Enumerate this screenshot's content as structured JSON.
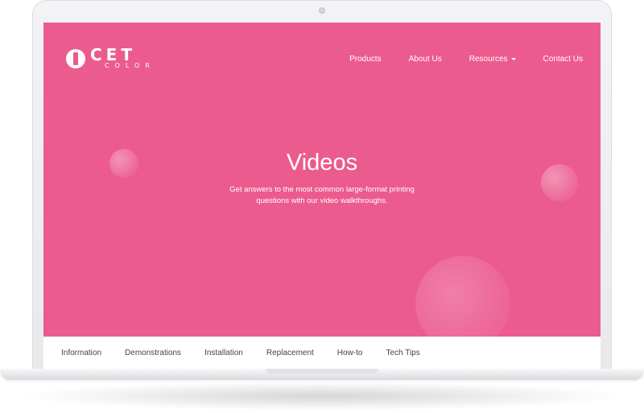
{
  "brand": {
    "logo_word": "CET",
    "logo_sub": "COLOR"
  },
  "nav": {
    "items": [
      {
        "label": "Products",
        "has_dropdown": false
      },
      {
        "label": "About Us",
        "has_dropdown": false
      },
      {
        "label": "Resources",
        "has_dropdown": true
      },
      {
        "label": "Contact Us",
        "has_dropdown": false
      }
    ]
  },
  "hero": {
    "title": "Videos",
    "subtitle_line1": "Get answers to the most common large-format printing",
    "subtitle_line2": "questions with our video walkthroughs."
  },
  "tabs": {
    "items": [
      {
        "label": "Information"
      },
      {
        "label": "Demonstrations"
      },
      {
        "label": "Installation"
      },
      {
        "label": "Replacement"
      },
      {
        "label": "How-to"
      },
      {
        "label": "Tech Tips"
      }
    ]
  },
  "colors": {
    "hero_background": "#ec5b8e",
    "text_on_hero": "#ffffff",
    "tab_text": "#444444"
  },
  "icons": {
    "dropdown": "caret-down-icon",
    "logo_mark": "cet-logo-icon"
  }
}
